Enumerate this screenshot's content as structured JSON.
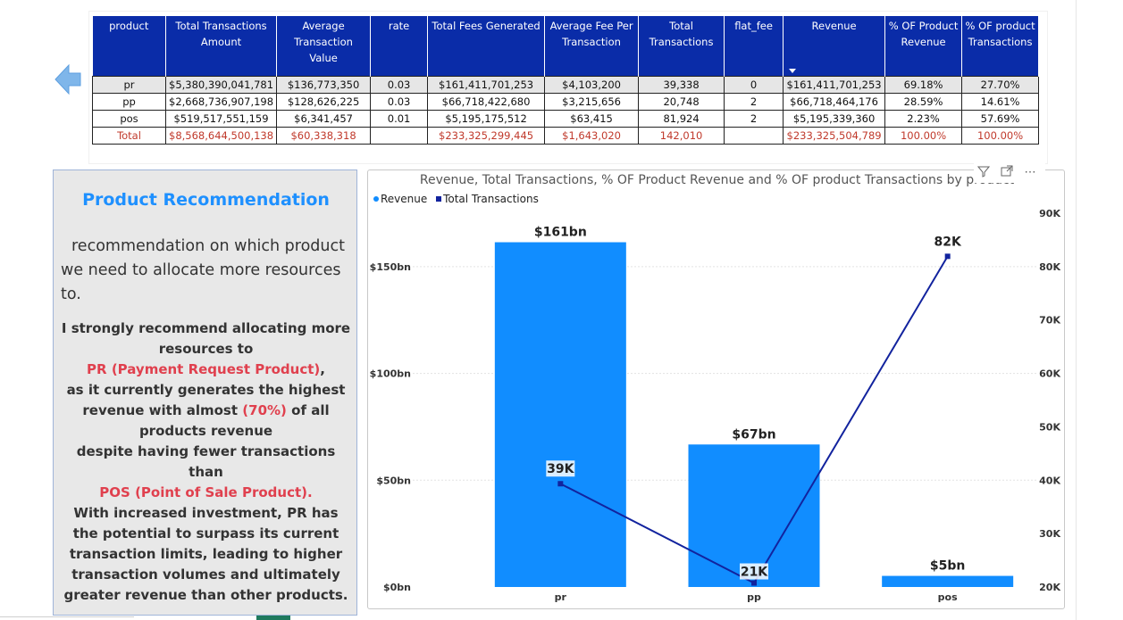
{
  "table": {
    "headers": [
      "product",
      "Total Transactions Amount",
      "Average Transaction Value",
      "rate",
      "Total Fees Generated",
      "Average Fee Per Transaction",
      "Total Transactions",
      "flat_fee",
      "Revenue",
      "% OF Product Revenue",
      "% OF product Transactions"
    ],
    "rows": [
      [
        "pr",
        "$5,380,390,041,781",
        "$136,773,350",
        "0.03",
        "$161,411,701,253",
        "$4,103,200",
        "39,338",
        "0",
        "$161,411,701,253",
        "69.18%",
        "27.70%"
      ],
      [
        "pp",
        "$2,668,736,907,198",
        "$128,626,225",
        "0.03",
        "$66,718,422,680",
        "$3,215,656",
        "20,748",
        "2",
        "$66,718,464,176",
        "28.59%",
        "14.61%"
      ],
      [
        "pos",
        "$519,517,551,159",
        "$6,341,457",
        "0.01",
        "$5,195,175,512",
        "$63,415",
        "81,924",
        "2",
        "$5,195,339,360",
        "2.23%",
        "57.69%"
      ]
    ],
    "total": [
      "Total",
      "$8,568,644,500,138",
      "$60,338,318",
      "",
      "$233,325,299,445",
      "$1,643,020",
      "142,010",
      "",
      "$233,325,504,789",
      "100.00%",
      "100.00%"
    ]
  },
  "recommendation": {
    "title": "Product Recommendation",
    "intro": "recommendation on which product we need to allocate more resources to.",
    "p1": "I strongly recommend allocating more resources to",
    "hl1": "PR (Payment Request Product)",
    "p1b": ",",
    "p2": "as it currently generates the highest revenue with almost",
    "hl2": "(70%)",
    "p2b": "of all products revenue",
    "p3": "despite having fewer transactions than",
    "hl3": "POS (Point of Sale Product).",
    "p4": "With increased investment, PR has the potential to surpass its current transaction limits, leading to higher transaction volumes and ultimately greater revenue than other products."
  },
  "chart_title": "Revenue, Total Transactions, % OF Product Revenue and % OF product Transactions by product",
  "legend": {
    "revenue": "Revenue",
    "transactions": "Total  Transactions"
  },
  "colors": {
    "revenue": "#118dff",
    "transactions": "#12239e",
    "header": "#0a2ca8",
    "highlight": "#e0404e"
  },
  "icons": {
    "back": "back-arrow-icon",
    "filter": "filter-icon",
    "focus": "focus-mode-icon",
    "more": "more-options-icon"
  },
  "chart_data": {
    "type": "bar",
    "categories": [
      "pr",
      "pp",
      "pos"
    ],
    "series": [
      {
        "name": "Revenue",
        "type": "bar",
        "axis": "left",
        "values": [
          161.41,
          66.72,
          5.2
        ],
        "labels": [
          "$161bn",
          "$67bn",
          "$5bn"
        ]
      },
      {
        "name": "Total  Transactions",
        "type": "line",
        "axis": "right",
        "values": [
          39338,
          20748,
          81924
        ],
        "labels": [
          "39K",
          "21K",
          "82K"
        ]
      }
    ],
    "y_left": {
      "ticks": [
        0,
        50,
        100,
        150
      ],
      "tick_labels": [
        "$0bn",
        "$50bn",
        "$100bn",
        "$150bn"
      ],
      "range": [
        0,
        175
      ]
    },
    "y_right": {
      "ticks": [
        20000,
        30000,
        40000,
        50000,
        60000,
        70000,
        80000,
        90000
      ],
      "tick_labels": [
        "20K",
        "30K",
        "40K",
        "50K",
        "60K",
        "70K",
        "80K",
        "90K"
      ],
      "range": [
        20000,
        90000
      ]
    },
    "grid": true,
    "legend_position": "top-left"
  }
}
